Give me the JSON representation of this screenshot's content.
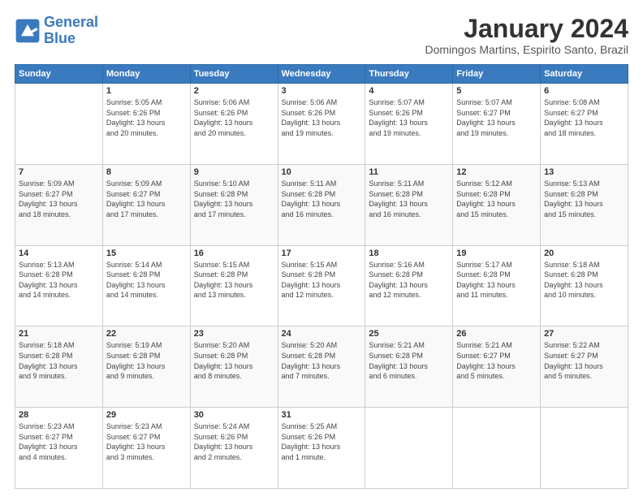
{
  "header": {
    "logo_text_general": "General",
    "logo_text_blue": "Blue",
    "month_title": "January 2024",
    "location": "Domingos Martins, Espirito Santo, Brazil"
  },
  "days_of_week": [
    "Sunday",
    "Monday",
    "Tuesday",
    "Wednesday",
    "Thursday",
    "Friday",
    "Saturday"
  ],
  "weeks": [
    [
      {
        "day": "",
        "info": ""
      },
      {
        "day": "1",
        "info": "Sunrise: 5:05 AM\nSunset: 6:26 PM\nDaylight: 13 hours\nand 20 minutes."
      },
      {
        "day": "2",
        "info": "Sunrise: 5:06 AM\nSunset: 6:26 PM\nDaylight: 13 hours\nand 20 minutes."
      },
      {
        "day": "3",
        "info": "Sunrise: 5:06 AM\nSunset: 6:26 PM\nDaylight: 13 hours\nand 19 minutes."
      },
      {
        "day": "4",
        "info": "Sunrise: 5:07 AM\nSunset: 6:26 PM\nDaylight: 13 hours\nand 19 minutes."
      },
      {
        "day": "5",
        "info": "Sunrise: 5:07 AM\nSunset: 6:27 PM\nDaylight: 13 hours\nand 19 minutes."
      },
      {
        "day": "6",
        "info": "Sunrise: 5:08 AM\nSunset: 6:27 PM\nDaylight: 13 hours\nand 18 minutes."
      }
    ],
    [
      {
        "day": "7",
        "info": "Sunrise: 5:09 AM\nSunset: 6:27 PM\nDaylight: 13 hours\nand 18 minutes."
      },
      {
        "day": "8",
        "info": "Sunrise: 5:09 AM\nSunset: 6:27 PM\nDaylight: 13 hours\nand 17 minutes."
      },
      {
        "day": "9",
        "info": "Sunrise: 5:10 AM\nSunset: 6:28 PM\nDaylight: 13 hours\nand 17 minutes."
      },
      {
        "day": "10",
        "info": "Sunrise: 5:11 AM\nSunset: 6:28 PM\nDaylight: 13 hours\nand 16 minutes."
      },
      {
        "day": "11",
        "info": "Sunrise: 5:11 AM\nSunset: 6:28 PM\nDaylight: 13 hours\nand 16 minutes."
      },
      {
        "day": "12",
        "info": "Sunrise: 5:12 AM\nSunset: 6:28 PM\nDaylight: 13 hours\nand 15 minutes."
      },
      {
        "day": "13",
        "info": "Sunrise: 5:13 AM\nSunset: 6:28 PM\nDaylight: 13 hours\nand 15 minutes."
      }
    ],
    [
      {
        "day": "14",
        "info": "Sunrise: 5:13 AM\nSunset: 6:28 PM\nDaylight: 13 hours\nand 14 minutes."
      },
      {
        "day": "15",
        "info": "Sunrise: 5:14 AM\nSunset: 6:28 PM\nDaylight: 13 hours\nand 14 minutes."
      },
      {
        "day": "16",
        "info": "Sunrise: 5:15 AM\nSunset: 6:28 PM\nDaylight: 13 hours\nand 13 minutes."
      },
      {
        "day": "17",
        "info": "Sunrise: 5:15 AM\nSunset: 6:28 PM\nDaylight: 13 hours\nand 12 minutes."
      },
      {
        "day": "18",
        "info": "Sunrise: 5:16 AM\nSunset: 6:28 PM\nDaylight: 13 hours\nand 12 minutes."
      },
      {
        "day": "19",
        "info": "Sunrise: 5:17 AM\nSunset: 6:28 PM\nDaylight: 13 hours\nand 11 minutes."
      },
      {
        "day": "20",
        "info": "Sunrise: 5:18 AM\nSunset: 6:28 PM\nDaylight: 13 hours\nand 10 minutes."
      }
    ],
    [
      {
        "day": "21",
        "info": "Sunrise: 5:18 AM\nSunset: 6:28 PM\nDaylight: 13 hours\nand 9 minutes."
      },
      {
        "day": "22",
        "info": "Sunrise: 5:19 AM\nSunset: 6:28 PM\nDaylight: 13 hours\nand 9 minutes."
      },
      {
        "day": "23",
        "info": "Sunrise: 5:20 AM\nSunset: 6:28 PM\nDaylight: 13 hours\nand 8 minutes."
      },
      {
        "day": "24",
        "info": "Sunrise: 5:20 AM\nSunset: 6:28 PM\nDaylight: 13 hours\nand 7 minutes."
      },
      {
        "day": "25",
        "info": "Sunrise: 5:21 AM\nSunset: 6:28 PM\nDaylight: 13 hours\nand 6 minutes."
      },
      {
        "day": "26",
        "info": "Sunrise: 5:21 AM\nSunset: 6:27 PM\nDaylight: 13 hours\nand 5 minutes."
      },
      {
        "day": "27",
        "info": "Sunrise: 5:22 AM\nSunset: 6:27 PM\nDaylight: 13 hours\nand 5 minutes."
      }
    ],
    [
      {
        "day": "28",
        "info": "Sunrise: 5:23 AM\nSunset: 6:27 PM\nDaylight: 13 hours\nand 4 minutes."
      },
      {
        "day": "29",
        "info": "Sunrise: 5:23 AM\nSunset: 6:27 PM\nDaylight: 13 hours\nand 3 minutes."
      },
      {
        "day": "30",
        "info": "Sunrise: 5:24 AM\nSunset: 6:26 PM\nDaylight: 13 hours\nand 2 minutes."
      },
      {
        "day": "31",
        "info": "Sunrise: 5:25 AM\nSunset: 6:26 PM\nDaylight: 13 hours\nand 1 minute."
      },
      {
        "day": "",
        "info": ""
      },
      {
        "day": "",
        "info": ""
      },
      {
        "day": "",
        "info": ""
      }
    ]
  ]
}
